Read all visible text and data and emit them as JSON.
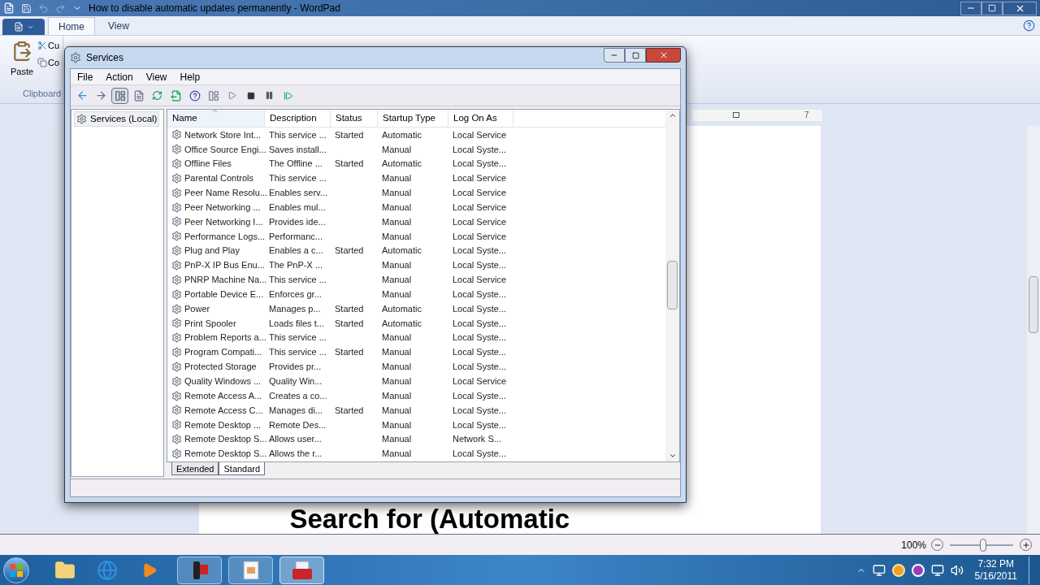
{
  "wordpad": {
    "title": "How to disable automatic updates permanently - WordPad",
    "tabs": [
      {
        "label": "Home",
        "selected": true
      },
      {
        "label": "View",
        "selected": false
      }
    ],
    "ribbon": {
      "paste": "Paste",
      "cut": "Cu",
      "copy": "Co",
      "group": "Clipboard"
    },
    "ruler_mark": "7",
    "document_text": "Search for (Automatic",
    "zoom": {
      "reading": "100%",
      "level": 0.52
    }
  },
  "services": {
    "title": "Services",
    "menu": [
      "File",
      "Action",
      "View",
      "Help"
    ],
    "tree": [
      {
        "label": "Services (Local)",
        "selected": true
      }
    ],
    "columns": [
      "Name",
      "Description",
      "Status",
      "Startup Type",
      "Log On As"
    ],
    "rows": [
      [
        "Network Store Int...",
        "This service ...",
        "Started",
        "Automatic",
        "Local Service"
      ],
      [
        "Office Source Engi...",
        "Saves install...",
        "",
        "Manual",
        "Local Syste..."
      ],
      [
        "Offline Files",
        "The Offline ...",
        "Started",
        "Automatic",
        "Local Syste..."
      ],
      [
        "Parental Controls",
        "This service ...",
        "",
        "Manual",
        "Local Service"
      ],
      [
        "Peer Name Resolu...",
        "Enables serv...",
        "",
        "Manual",
        "Local Service"
      ],
      [
        "Peer Networking ...",
        "Enables mul...",
        "",
        "Manual",
        "Local Service"
      ],
      [
        "Peer Networking I...",
        "Provides ide...",
        "",
        "Manual",
        "Local Service"
      ],
      [
        "Performance Logs...",
        "Performanc...",
        "",
        "Manual",
        "Local Service"
      ],
      [
        "Plug and Play",
        "Enables a c...",
        "Started",
        "Automatic",
        "Local Syste..."
      ],
      [
        "PnP-X IP Bus Enu...",
        "The PnP-X ...",
        "",
        "Manual",
        "Local Syste..."
      ],
      [
        "PNRP Machine Na...",
        "This service ...",
        "",
        "Manual",
        "Local Service"
      ],
      [
        "Portable Device E...",
        "Enforces gr...",
        "",
        "Manual",
        "Local Syste..."
      ],
      [
        "Power",
        "Manages p...",
        "Started",
        "Automatic",
        "Local Syste..."
      ],
      [
        "Print Spooler",
        "Loads files t...",
        "Started",
        "Automatic",
        "Local Syste..."
      ],
      [
        "Problem Reports a...",
        "This service ...",
        "",
        "Manual",
        "Local Syste..."
      ],
      [
        "Program Compati...",
        "This service ...",
        "Started",
        "Manual",
        "Local Syste..."
      ],
      [
        "Protected Storage",
        "Provides pr...",
        "",
        "Manual",
        "Local Syste..."
      ],
      [
        "Quality Windows ...",
        "Quality Win...",
        "",
        "Manual",
        "Local Service"
      ],
      [
        "Remote Access A...",
        "Creates a co...",
        "",
        "Manual",
        "Local Syste..."
      ],
      [
        "Remote Access C...",
        "Manages di...",
        "Started",
        "Manual",
        "Local Syste..."
      ],
      [
        "Remote Desktop ...",
        "Remote Des...",
        "",
        "Manual",
        "Local Syste..."
      ],
      [
        "Remote Desktop S...",
        "Allows user...",
        "",
        "Manual",
        "Network S..."
      ],
      [
        "Remote Desktop S...",
        "Allows the r...",
        "",
        "Manual",
        "Local Syste..."
      ]
    ],
    "view_tabs": [
      {
        "label": "Extended",
        "selected": false
      },
      {
        "label": "Standard",
        "selected": true
      }
    ]
  },
  "taskbar": {
    "time": "7:32 PM",
    "date": "5/16/2011"
  }
}
